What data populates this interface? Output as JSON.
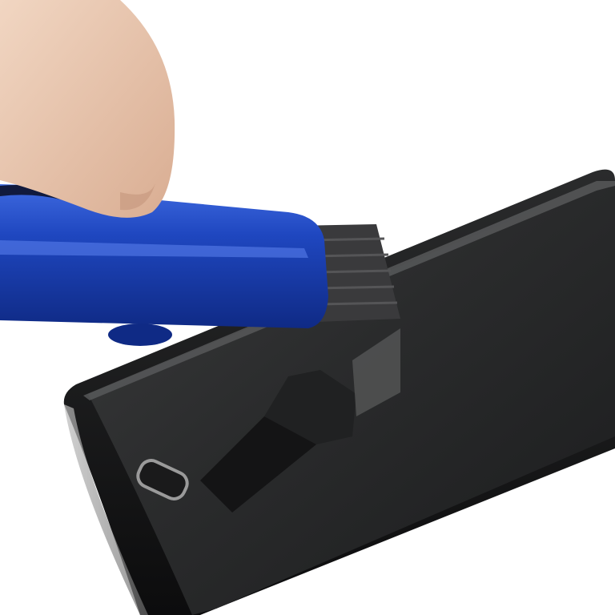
{
  "photo": {
    "subject": "",
    "colors": {
      "background": "#ffffff",
      "phone_body": "#141516",
      "phone_screen": "#2b2c2d",
      "cutter_handle": "#1b3fb0",
      "cutter_highlight": "#3f6ae0",
      "blade": "#3a3a3c",
      "skin": "#e9c8b0"
    }
  }
}
